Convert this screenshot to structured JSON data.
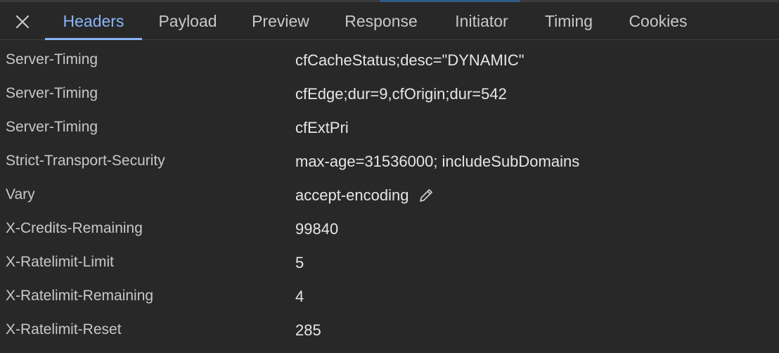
{
  "tabs": [
    {
      "label": "Headers",
      "active": true
    },
    {
      "label": "Payload",
      "active": false
    },
    {
      "label": "Preview",
      "active": false
    },
    {
      "label": "Response",
      "active": false
    },
    {
      "label": "Initiator",
      "active": false
    },
    {
      "label": "Timing",
      "active": false
    },
    {
      "label": "Cookies",
      "active": false
    }
  ],
  "headers": [
    {
      "name": "Server-Timing",
      "value": "cfCacheStatus;desc=\"DYNAMIC\""
    },
    {
      "name": "Server-Timing",
      "value": "cfEdge;dur=9,cfOrigin;dur=542"
    },
    {
      "name": "Server-Timing",
      "value": "cfExtPri"
    },
    {
      "name": "Strict-Transport-Security",
      "value": "max-age=31536000; includeSubDomains"
    },
    {
      "name": "Vary",
      "value": "accept-encoding",
      "editable": true
    },
    {
      "name": "X-Credits-Remaining",
      "value": "99840"
    },
    {
      "name": "X-Ratelimit-Limit",
      "value": "5"
    },
    {
      "name": "X-Ratelimit-Remaining",
      "value": "4"
    },
    {
      "name": "X-Ratelimit-Reset",
      "value": "285"
    }
  ],
  "icons": {
    "close": "close-icon",
    "edit": "pencil-icon"
  },
  "colors": {
    "background": "#282828",
    "active_tab": "#8ab4f8",
    "text": "#c8c8c8"
  }
}
